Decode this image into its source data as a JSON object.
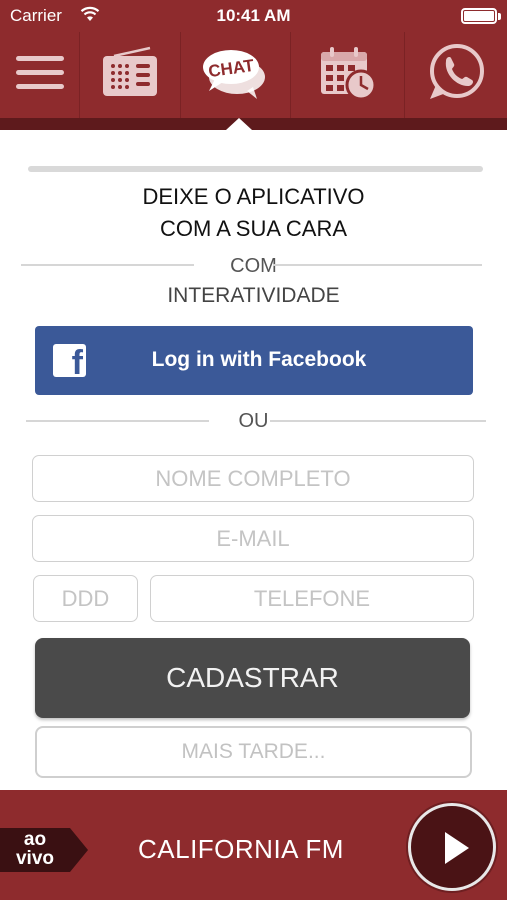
{
  "status_bar": {
    "carrier": "Carrier",
    "time": "10:41 AM"
  },
  "nav": {
    "items": [
      {
        "icon": "menu-icon"
      },
      {
        "icon": "radio-icon"
      },
      {
        "icon": "chat-icon",
        "label": "CHAT",
        "active": true
      },
      {
        "icon": "calendar-icon"
      },
      {
        "icon": "whatsapp-icon"
      }
    ]
  },
  "signup": {
    "heading_line1": "DEIXE O APLICATIVO",
    "heading_line2": "COM A SUA CARA",
    "with_label": "COM",
    "interactivity_label": "INTERATIVIDADE",
    "facebook_button": "Log in with Facebook",
    "or_label": "OU",
    "name_placeholder": "NOME COMPLETO",
    "email_placeholder": "E-MAIL",
    "ddd_placeholder": "DDD",
    "phone_placeholder": "TELEFONE",
    "submit_label": "CADASTRAR",
    "later_label": "MAIS TARDE..."
  },
  "player": {
    "live_line1": "ao",
    "live_line2": "vivo",
    "station": "CALIFORNIA FM"
  },
  "colors": {
    "brand": "#8e2b2d",
    "brand_dark": "#5e1a1c",
    "facebook": "#3b5998",
    "submit": "#4a4a4a"
  }
}
